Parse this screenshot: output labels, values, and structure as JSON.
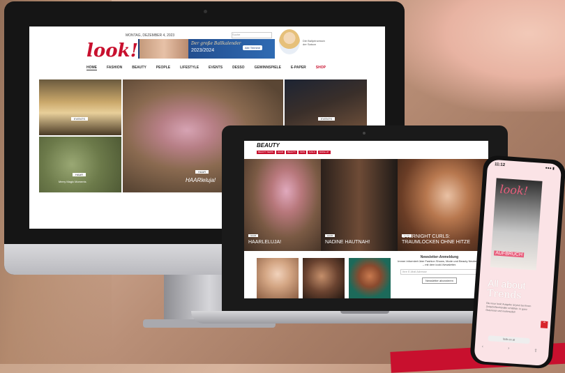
{
  "desktop_site": {
    "brand_logo": "look!",
    "top_bar": "MONTAG, DEZEMBER 4, 2023",
    "search_placeholder": "Suche",
    "banner": {
      "line1": "Der große Ballkalender",
      "line2": "2023/2024",
      "button": "Alle Termine"
    },
    "promo_text": "Die Ballprinzessin der Saison",
    "nav_items": [
      "HOME",
      "FASHION",
      "BEAUTY",
      "PEOPLE",
      "LIFESTYLE",
      "EVENTS",
      "DESSO",
      "GEWINNSPIELE",
      "E-PAPER",
      "SHOP"
    ],
    "tiles": [
      {
        "label": "EVENTS",
        "caption": ""
      },
      {
        "label": "HAAR",
        "caption": "Merry Magic Moments"
      },
      {
        "label": "HAAR",
        "caption": "HAARleluja!"
      },
      {
        "label": "EVENTS",
        "caption": ""
      }
    ]
  },
  "laptop_site": {
    "section_title": "BEAUTY",
    "tags": [
      "BEAUTY NEWS",
      "HAAR",
      "BEAUTY",
      "SKIN",
      "NAILS",
      "MAKE-UP"
    ],
    "tiles": [
      {
        "pill": "HAAR",
        "caption": "HAARLELUJA!"
      },
      {
        "pill": "HAAR",
        "caption": "NADINE HAUTNAH!"
      },
      {
        "pill": "HAAR",
        "caption": "OVERNIGHT CURLS: TRAUMLOCKEN OHNE HITZE"
      }
    ],
    "newsletter": {
      "heading": "Newsletter-Anmeldung",
      "text": "Immer informiert über Fashion Shows, Mode und Beauty Neuheiten – mit dem look!-Newsletter.",
      "input_placeholder": "Ihre E-Mail Adresse",
      "button": "Newsletter abonnieren"
    }
  },
  "phone_site": {
    "time": "11:12",
    "signal": "●●● ▮",
    "magazine_title": "look!",
    "magazine_cover_text": "AUFBRUCH",
    "headline": "All about",
    "headline2": "Trends",
    "description": "Die neue look! Ausgabe ist jetzt bei Ihrem Zeitschriftenhändler erhältlich. In ganz Österreich und multimedial!",
    "url": "look.co.at",
    "nav_icons": [
      "back-icon",
      "forward-icon",
      "share-icon"
    ]
  }
}
